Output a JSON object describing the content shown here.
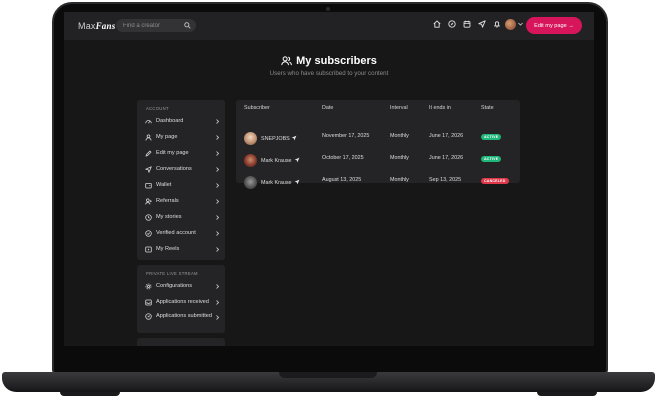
{
  "nav": {
    "logo_left": "Max",
    "logo_right": "Fans",
    "search_placeholder": "Find a creator",
    "edit_button": "Edit my page →"
  },
  "heading": {
    "title": "My subscribers",
    "subtitle": "Users who have subscribed to your content"
  },
  "sidebar": {
    "account_header": "ACCOUNT",
    "account_items": [
      {
        "label": "Dashboard",
        "icon": "dashboard-icon"
      },
      {
        "label": "My page",
        "icon": "user-icon"
      },
      {
        "label": "Edit my page",
        "icon": "pencil-icon"
      },
      {
        "label": "Conversations",
        "icon": "send-icon"
      },
      {
        "label": "Wallet",
        "icon": "wallet-icon"
      },
      {
        "label": "Referrals",
        "icon": "user-plus-icon"
      },
      {
        "label": "My stories",
        "icon": "clock-icon"
      },
      {
        "label": "Verified account",
        "icon": "check-circle-icon"
      },
      {
        "label": "My Reels",
        "icon": "film-icon"
      }
    ],
    "stream_header": "PRIVATE LIVE STREAM",
    "stream_items": [
      {
        "label": "Configurations",
        "icon": "gear-icon"
      },
      {
        "label": "Applications received",
        "icon": "inbox-icon"
      },
      {
        "label": "Applications submitted",
        "icon": "send-circle-icon"
      }
    ]
  },
  "table": {
    "headers": [
      "Subscriber",
      "Date",
      "Interval",
      "It ends in",
      "State"
    ],
    "rows": [
      {
        "name": "SNEPJOBS",
        "date": "November 17, 2025",
        "interval": "Monthly",
        "ends": "June 17, 2026",
        "state": "ACTIVE",
        "state_color": "#1fb67a"
      },
      {
        "name": "Mark Krause",
        "date": "October 17, 2025",
        "interval": "Monthly",
        "ends": "June 17, 2026",
        "state": "ACTIVE",
        "state_color": "#1fb67a"
      },
      {
        "name": "Mark Krause",
        "date": "August 13, 2025",
        "interval": "Monthly",
        "ends": "Sep 13, 2025",
        "state": "CANCELED",
        "state_color": "#e0384b"
      }
    ]
  },
  "colors": {
    "accent": "#d6155a",
    "active": "#1fb67a",
    "canceled": "#e0384b",
    "screen_bg": "#171717",
    "card_bg": "#242426"
  }
}
